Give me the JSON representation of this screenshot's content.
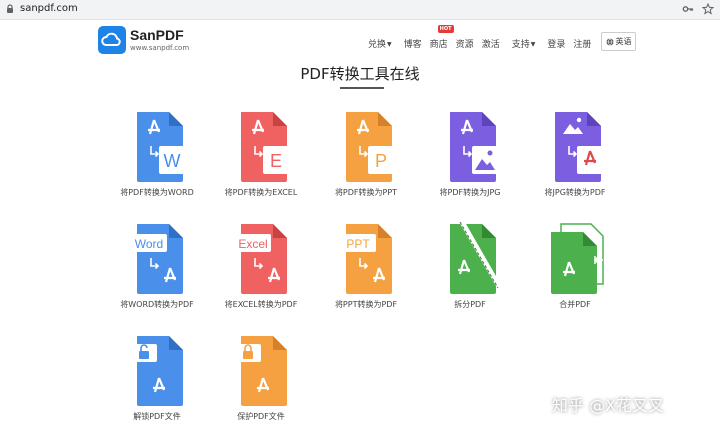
{
  "browser": {
    "url": "sanpdf.com"
  },
  "header": {
    "logo_name": "SanPDF",
    "logo_url": "www.sanpdf.com",
    "nav": [
      {
        "label": "兑换",
        "caret": true
      },
      {
        "label": "博客"
      },
      {
        "label": "商店",
        "badge": "HOT"
      },
      {
        "label": "资源"
      },
      {
        "label": "激活"
      },
      {
        "label": "支持",
        "caret": true
      },
      {
        "label": "登录"
      },
      {
        "label": "注册"
      }
    ],
    "language": "英语"
  },
  "page_title": "PDF转换工具在线",
  "colors": {
    "word": "#4a8fea",
    "excel": "#f06262",
    "ppt": "#f5a142",
    "jpg": "#7b5fe0",
    "green": "#4cb04c",
    "brand": "#1d83e6"
  },
  "tools": [
    {
      "label": "将PDF转换为WORD",
      "icon": "pdf-to-word-icon"
    },
    {
      "label": "将PDF转换为EXCEL",
      "icon": "pdf-to-excel-icon"
    },
    {
      "label": "将PDF转换为PPT",
      "icon": "pdf-to-ppt-icon"
    },
    {
      "label": "将PDF转换为JPG",
      "icon": "pdf-to-jpg-icon"
    },
    {
      "label": "将JPG转换为PDF",
      "icon": "jpg-to-pdf-icon"
    },
    {
      "label": "将WORD转换为PDF",
      "icon": "word-to-pdf-icon"
    },
    {
      "label": "将EXCEL转换为PDF",
      "icon": "excel-to-pdf-icon"
    },
    {
      "label": "将PPT转换为PDF",
      "icon": "ppt-to-pdf-icon"
    },
    {
      "label": "拆分PDF",
      "icon": "split-pdf-icon"
    },
    {
      "label": "合并PDF",
      "icon": "merge-pdf-icon"
    },
    {
      "label": "解锁PDF文件",
      "icon": "unlock-pdf-icon"
    },
    {
      "label": "保护PDF文件",
      "icon": "protect-pdf-icon"
    }
  ],
  "icon_text": {
    "w": "W",
    "e": "E",
    "p": "P",
    "word": "Word",
    "excel": "Excel",
    "ppt": "PPT"
  },
  "watermark": "知乎 @X花叉叉"
}
